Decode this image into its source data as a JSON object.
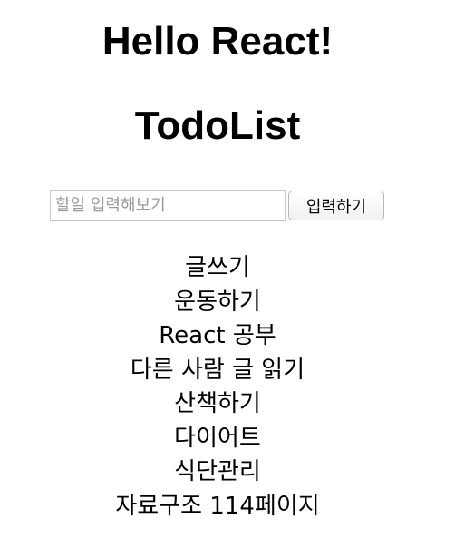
{
  "header": {
    "hello": "Hello React!",
    "title": "TodoList"
  },
  "form": {
    "input_value": "",
    "input_placeholder": "할일 입력해보기",
    "add_label": "입력하기"
  },
  "todos": [
    "글쓰기",
    "운동하기",
    "React 공부",
    "다른 사람 글 읽기",
    "산책하기",
    "다이어트",
    "식단관리",
    "자료구조 114페이지"
  ]
}
